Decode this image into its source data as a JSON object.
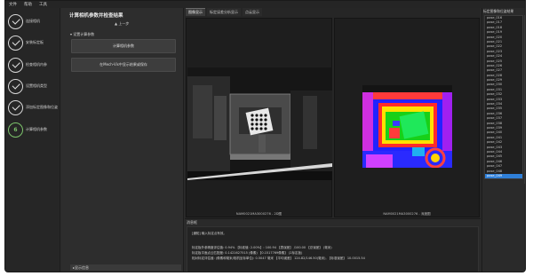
{
  "menu": {
    "items": [
      "文件",
      "帮助",
      "工具"
    ]
  },
  "steps": [
    {
      "label": "连接相机",
      "state": "done"
    },
    {
      "label": "安装标定板",
      "state": "done"
    },
    {
      "label": "检查相机内参",
      "state": "done"
    },
    {
      "label": "设置相机类型",
      "state": "done"
    },
    {
      "label": "添加标定图像和位姿",
      "state": "done"
    },
    {
      "label": "计算相机参数",
      "state": "current",
      "number": "6"
    }
  ],
  "panel": {
    "title": "计算相机参数并检查结果",
    "back_label": "上一步",
    "group_label": "设置计算参数",
    "btn_compute": "计算相机参数",
    "btn_save": "在Mech-Vis中显示结果或保存",
    "footer_label": "显示信息"
  },
  "tabs": [
    "图像显示",
    "标定误差分析显示",
    "点云显示"
  ],
  "viewers": {
    "left_caption": "NAM0021MA3000276 - 2D图",
    "right_caption": "NAM0021MA3000276 - 深度图"
  },
  "log": {
    "header": "消息框",
    "lines": [
      "[通知] 输入标定点有效。",
      "标定板外参精度评估值: 0.94%  【标准值: 2.00%】: 100.94 【表误差】 /100.00 【总误差】 (毫米)",
      "标定板平面点云匹配度: 0.1421627515 (像素) 【0.1517769像素】 (2标定板)",
      "相对标定评估值: (像素和毫米/相机坐标单位): 0.5047 毫米   【平均误差】 124.82/146.50(毫米),   【标准误差】 10.0015.54"
    ]
  },
  "pose_list": {
    "title": "标定图像和位姿结果",
    "items": [
      "pose_016",
      "pose_017",
      "pose_018",
      "pose_019",
      "pose_020",
      "pose_021",
      "pose_022",
      "pose_023",
      "pose_024",
      "pose_025",
      "pose_026",
      "pose_027",
      "pose_028",
      "pose_029",
      "pose_030",
      "pose_031",
      "pose_032",
      "pose_033",
      "pose_034",
      "pose_035",
      "pose_036",
      "pose_037",
      "pose_038",
      "pose_039",
      "pose_040",
      "pose_041",
      "pose_042",
      "pose_043",
      "pose_044",
      "pose_045",
      "pose_046",
      "pose_047",
      "pose_048",
      "pose_049"
    ],
    "selected": "pose_049"
  },
  "colors": {
    "accent": "#2f7fd8",
    "current_step": "#7cc36b",
    "background": "#2b2b2b"
  }
}
